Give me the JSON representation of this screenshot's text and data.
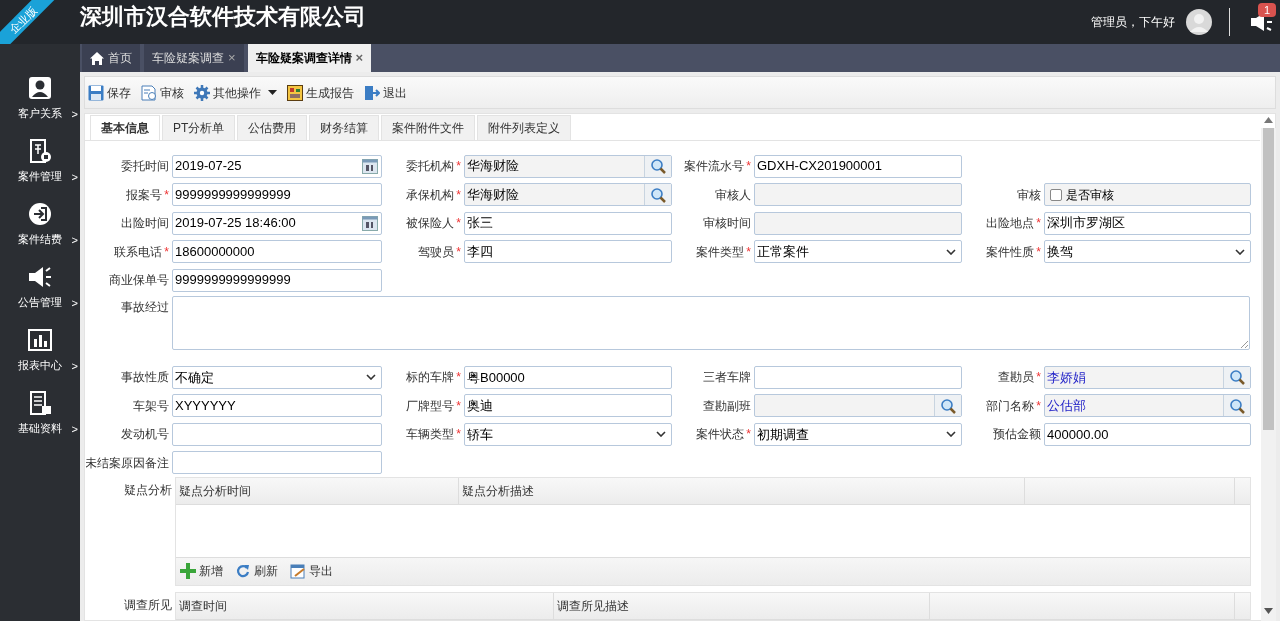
{
  "ribbon": "企业版",
  "header": {
    "title": "深圳市汉合软件技术有限公司",
    "greeting": "管理员，下午好",
    "notification_count": "1"
  },
  "sidebar": {
    "items": [
      {
        "label": "客户关系",
        "kind": "person",
        "arrow": ">"
      },
      {
        "label": "案件管理",
        "kind": "case",
        "arrow": ">"
      },
      {
        "label": "案件结费",
        "kind": "enter",
        "arrow": ">"
      },
      {
        "label": "公告管理",
        "kind": "megaphone",
        "arrow": ">"
      },
      {
        "label": "报表中心",
        "kind": "chart",
        "arrow": ">"
      },
      {
        "label": "基础资料",
        "kind": "list",
        "arrow": ">"
      }
    ]
  },
  "tabs": [
    {
      "label": "首页",
      "kind": "home",
      "selected": false
    },
    {
      "label": "车险疑案调查",
      "close": "×",
      "selected": false
    },
    {
      "label": "车险疑案调查详情",
      "close": "×",
      "selected": true
    }
  ],
  "toolbar": [
    {
      "label": "保存",
      "kind": "save"
    },
    {
      "label": "审核",
      "kind": "audit"
    },
    {
      "label": "其他操作",
      "kind": "gear",
      "dropdown": true
    },
    {
      "label": "生成报告",
      "kind": "report"
    },
    {
      "label": "退出",
      "kind": "exit"
    }
  ],
  "sub_tabs": [
    {
      "label": "基本信息",
      "selected": true
    },
    {
      "label": "PT分析单",
      "selected": false
    },
    {
      "label": "公估费用",
      "selected": false
    },
    {
      "label": "财务结算",
      "selected": false
    },
    {
      "label": "案件附件文件",
      "selected": false
    },
    {
      "label": "附件列表定义",
      "selected": false
    }
  ],
  "form": {
    "rows": [
      [
        {
          "label": "委托时间",
          "kind": "date",
          "value": "2019-07-25",
          "readonly": false
        },
        {
          "label": "委托机构",
          "mark": "*",
          "kind": "lookup",
          "value": "华海财险",
          "readonly": true
        },
        {
          "label": "案件流水号",
          "mark": "*",
          "kind": "text",
          "value": "GDXH-CX201900001",
          "readonly": false
        }
      ],
      [
        {
          "label": "报案号",
          "mark": "*",
          "kind": "text",
          "value": "9999999999999999",
          "readonly": false
        },
        {
          "label": "承保机构",
          "mark": "*",
          "kind": "lookup",
          "value": "华海财险",
          "readonly": true
        },
        {
          "label": "审核人",
          "kind": "text",
          "readonly": true
        },
        {
          "label": "审核",
          "kind": "checkbox",
          "text": "是否审核",
          "checked": false,
          "readonly": true
        }
      ],
      [
        {
          "label": "出险时间",
          "kind": "date",
          "value": "2019-07-25 18:46:00",
          "readonly": false
        },
        {
          "label": "被保险人",
          "mark": "*",
          "kind": "text",
          "value": "张三",
          "readonly": false
        },
        {
          "label": "审核时间",
          "kind": "text",
          "readonly": true
        },
        {
          "label": "出险地点",
          "mark": "*",
          "kind": "text",
          "value": "深圳市罗湖区",
          "readonly": false
        }
      ],
      [
        {
          "label": "联系电话",
          "mark": "*",
          "kind": "text",
          "value": "18600000000",
          "readonly": false
        },
        {
          "label": "驾驶员",
          "mark": "*",
          "kind": "text",
          "value": "李四",
          "readonly": false
        },
        {
          "label": "案件类型",
          "mark": "*",
          "kind": "select",
          "value": "正常案件",
          "readonly": false
        },
        {
          "label": "案件性质",
          "mark": "*",
          "kind": "select",
          "value": "换驾",
          "readonly": false
        }
      ],
      [
        {
          "label": "商业保单号",
          "kind": "text",
          "value": "9999999999999999",
          "readonly": false
        }
      ],
      [
        {
          "label": "事故经过",
          "kind": "textarea",
          "readonly": false
        }
      ],
      [
        {
          "label": "事故性质",
          "kind": "select",
          "value": "不确定",
          "readonly": false
        },
        {
          "label": "标的车牌",
          "mark": "*",
          "kind": "text",
          "value": "粤B00000",
          "readonly": false
        },
        {
          "label": "三者车牌",
          "kind": "text",
          "readonly": false
        },
        {
          "label": "查勘员",
          "mark": "*",
          "kind": "lookup",
          "value": "李娇娟",
          "readonly": true,
          "linked": true
        }
      ],
      [
        {
          "label": "车架号",
          "kind": "text",
          "value": "XYYYYYY",
          "readonly": false
        },
        {
          "label": "厂牌型号",
          "mark": "*",
          "kind": "text",
          "value": "奥迪",
          "readonly": false
        },
        {
          "label": "查勘副班",
          "kind": "lookup",
          "readonly": true
        },
        {
          "label": "部门名称",
          "mark": "*",
          "kind": "lookup",
          "value": "公估部",
          "readonly": true,
          "linked": true
        }
      ],
      [
        {
          "label": "发动机号",
          "kind": "text",
          "readonly": false
        },
        {
          "label": "车辆类型",
          "mark": "*",
          "kind": "select",
          "value": "轿车",
          "readonly": false
        },
        {
          "label": "案件状态",
          "mark": "*",
          "kind": "select",
          "value": "初期调查",
          "readonly": false
        },
        {
          "label": "预估金额",
          "kind": "text",
          "value": "400000.00",
          "readonly": false
        }
      ],
      [
        {
          "label": "未结案原因备注",
          "kind": "text",
          "readonly": false
        }
      ]
    ]
  },
  "grids": [
    {
      "label": "疑点分析",
      "columns": [
        "疑点分析时间",
        "疑点分析描述"
      ],
      "actions": [
        {
          "label": "新增",
          "kind": "add"
        },
        {
          "label": "刷新",
          "kind": "refresh"
        },
        {
          "label": "导出",
          "kind": "export"
        }
      ]
    },
    {
      "label": "调查所见",
      "columns": [
        "调查时间",
        "调查所见描述"
      ]
    }
  ]
}
